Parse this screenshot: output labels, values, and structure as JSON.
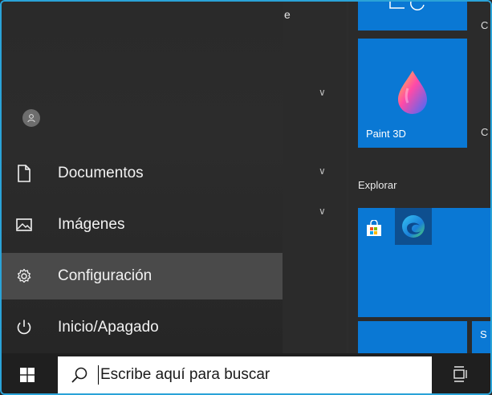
{
  "app_list": {
    "letter_header": "e"
  },
  "rail": {
    "items": [
      {
        "label": "Documentos",
        "icon": "document-icon"
      },
      {
        "label": "Imágenes",
        "icon": "pictures-icon"
      },
      {
        "label": "Configuración",
        "icon": "gear-icon",
        "active": true
      },
      {
        "label": "Inicio/Apagado",
        "icon": "power-icon"
      }
    ]
  },
  "tiles": {
    "paint3d_label": "Paint 3D",
    "section_explorar": "Explorar",
    "edge_letters": {
      "c1": "C",
      "c2": "C",
      "s": "S"
    }
  },
  "taskbar": {
    "search_placeholder": "Escribe aquí para buscar"
  },
  "colors": {
    "accent": "#0a78d4",
    "frame": "#2aa3d8"
  }
}
